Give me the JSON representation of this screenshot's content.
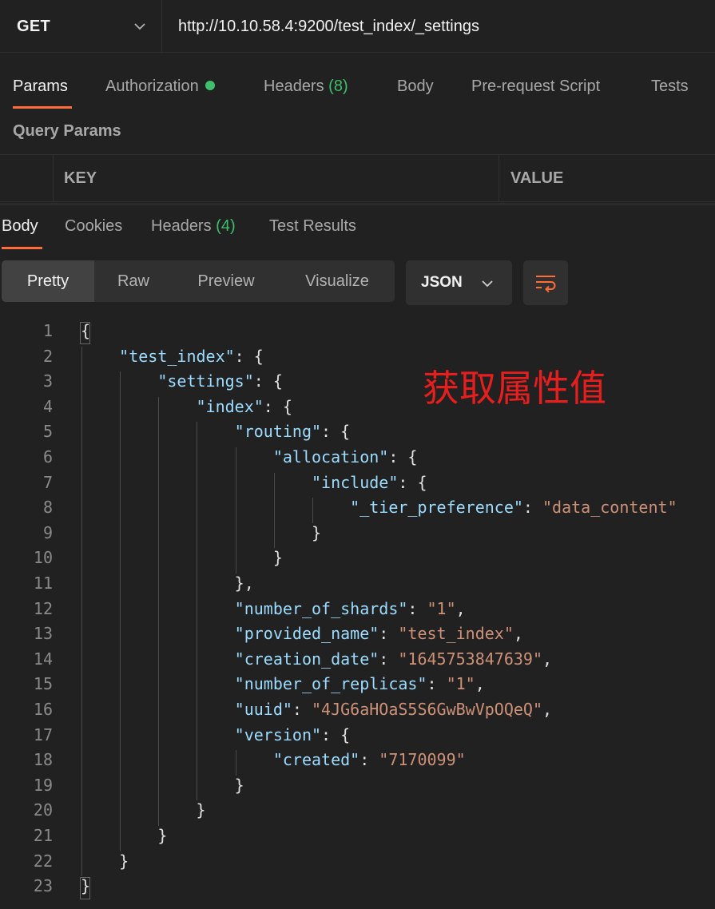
{
  "request": {
    "method": "GET",
    "url": "http://10.10.58.4:9200/test_index/_settings"
  },
  "request_tabs": {
    "params": "Params",
    "authorization": "Authorization",
    "headers": "Headers",
    "headers_count": "(8)",
    "body": "Body",
    "pre_request": "Pre-request Script",
    "tests": "Tests"
  },
  "query_params": {
    "title": "Query Params",
    "key_header": "KEY",
    "value_header": "VALUE"
  },
  "response_tabs": {
    "body": "Body",
    "cookies": "Cookies",
    "headers": "Headers",
    "headers_count": "(4)",
    "test_results": "Test Results"
  },
  "view_modes": {
    "pretty": "Pretty",
    "raw": "Raw",
    "preview": "Preview",
    "visualize": "Visualize"
  },
  "format": "JSON",
  "code_lines": [
    "{",
    "    \"test_index\": {",
    "        \"settings\": {",
    "            \"index\": {",
    "                \"routing\": {",
    "                    \"allocation\": {",
    "                        \"include\": {",
    "                            \"_tier_preference\": \"data_content\"",
    "                        }",
    "                    }",
    "                },",
    "                \"number_of_shards\": \"1\",",
    "                \"provided_name\": \"test_index\",",
    "                \"creation_date\": \"1645753847639\",",
    "                \"number_of_replicas\": \"1\",",
    "                \"uuid\": \"4JG6aHOaS5S6GwBwVpOQeQ\",",
    "                \"version\": {",
    "                    \"created\": \"7170099\"",
    "                }",
    "            }",
    "        }",
    "    }",
    "}"
  ],
  "annotation": "获取属性值",
  "colors": {
    "accent": "#ff6c37",
    "status_green": "#3fbf6b",
    "json_key": "#9cdcfe",
    "json_string": "#ce9178",
    "annotation": "#e61e1e"
  }
}
